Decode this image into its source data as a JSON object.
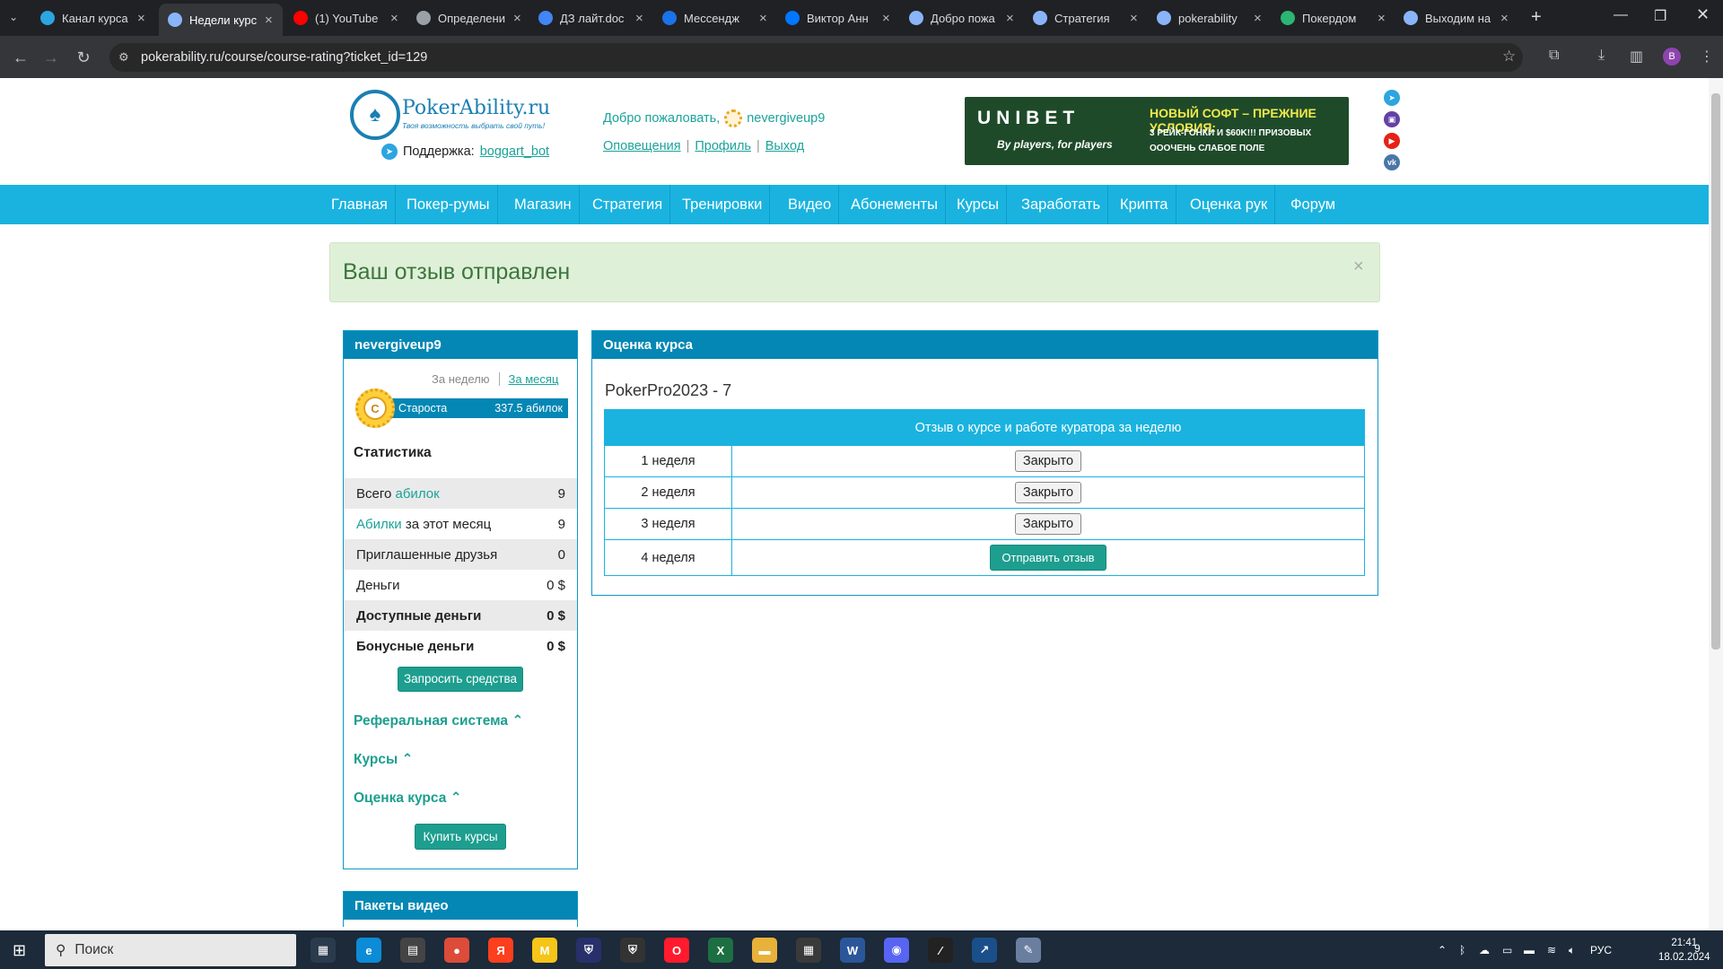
{
  "browser": {
    "tabs": [
      {
        "label": "Канал курса",
        "icon": "telegram-icon",
        "color": "#2ca5e0"
      },
      {
        "label": "Недели курс",
        "icon": "globe-icon",
        "color": "#8ab4f8"
      },
      {
        "label": "(1) YouTube",
        "icon": "youtube-icon",
        "color": "#ff0000"
      },
      {
        "label": "Определени",
        "icon": "globe-icon",
        "color": "#9aa0a6"
      },
      {
        "label": "ДЗ лайт.doc",
        "icon": "docs-icon",
        "color": "#4285f4"
      },
      {
        "label": "Мессендж",
        "icon": "messenger-icon",
        "color": "#1a73e8"
      },
      {
        "label": "Виктор Анн",
        "icon": "vk-icon",
        "color": "#0077ff"
      },
      {
        "label": "Добро пожа",
        "icon": "globe-icon",
        "color": "#8ab4f8"
      },
      {
        "label": "Стратегия",
        "icon": "globe-icon",
        "color": "#8ab4f8"
      },
      {
        "label": "pokerability",
        "icon": "globe-icon",
        "color": "#8ab4f8"
      },
      {
        "label": "Покердом",
        "icon": "pokerdom-icon",
        "color": "#2bb673"
      },
      {
        "label": "Выходим на",
        "icon": "globe-icon",
        "color": "#8ab4f8"
      }
    ],
    "url": "pokerability.ru/course/course-rating?ticket_id=129",
    "profile_initial": "B"
  },
  "header": {
    "logo_title": "PokerAbility.ru",
    "logo_subtitle": "Твоя возможность выбрать свой путь!",
    "support_label": "Поддержка:",
    "support_link": "boggart_bot",
    "welcome_text": "Добро пожаловать,",
    "username": "nevergiveup9",
    "links": [
      "Оповещения",
      "Профиль",
      "Выход"
    ],
    "banner": {
      "brand": "UNIBET",
      "tagline": "By players, for players",
      "headline": "НОВЫЙ СОФТ – ПРЕЖНИЕ УСЛОВИЯ:",
      "point1": "3 РЕЙК-ГОНКИ И $60K!!! ПРИЗОВЫХ",
      "point2": "ОООЧЕНЬ СЛАБОЕ ПОЛЕ"
    }
  },
  "nav": [
    "Главная",
    "Покер-румы",
    "Магазин",
    "Стратегия",
    "Тренировки",
    "Видео",
    "Абонементы",
    "Курсы",
    "Заработать",
    "Крипта",
    "Оценка рук",
    "Форум"
  ],
  "alert": {
    "text": "Ваш отзыв отправлен",
    "close": "×"
  },
  "sidebar": {
    "username": "nevergiveup9",
    "period_week": "За неделю",
    "period_month": "За месяц",
    "rank_letter": "C",
    "rank_label": "Староста",
    "rank_value": "337.5 абилок",
    "stats_title": "Статистика",
    "stats": [
      {
        "pre": "Всего ",
        "hl": "абилок",
        "post": "",
        "value": "9"
      },
      {
        "pre": "",
        "hl": "Абилки",
        "post": " за этот месяц",
        "value": "9"
      },
      {
        "pre": "Приглашенные друзья",
        "hl": "",
        "post": "",
        "value": "0"
      },
      {
        "pre": "Деньги",
        "hl": "",
        "post": "",
        "value": "0 $"
      },
      {
        "pre": "Доступные деньги",
        "hl": "",
        "post": "",
        "value": "0 $"
      },
      {
        "pre": "Бонусные деньги",
        "hl": "",
        "post": "",
        "value": "0 $"
      }
    ],
    "request_funds": "Запросить средства",
    "referral": "Реферальная система",
    "courses": "Курсы",
    "course_rating": "Оценка курса",
    "buy_courses": "Купить курсы",
    "video_packs": "Пакеты видео"
  },
  "main": {
    "panel_title": "Оценка курса",
    "course_name": "PokerPro2023 - 7",
    "table_header": "Отзыв о курсе и работе куратора за неделю",
    "weeks": [
      {
        "label": "1 неделя",
        "action": "Закрыто"
      },
      {
        "label": "2 неделя",
        "action": "Закрыто"
      },
      {
        "label": "3 неделя",
        "action": "Закрыто"
      },
      {
        "label": "4 неделя",
        "action": "Отправить отзыв"
      }
    ]
  },
  "taskbar": {
    "search_placeholder": "Поиск",
    "lang": "РУС",
    "time": "21:41",
    "date": "18.02.2024",
    "notifications": "9"
  }
}
